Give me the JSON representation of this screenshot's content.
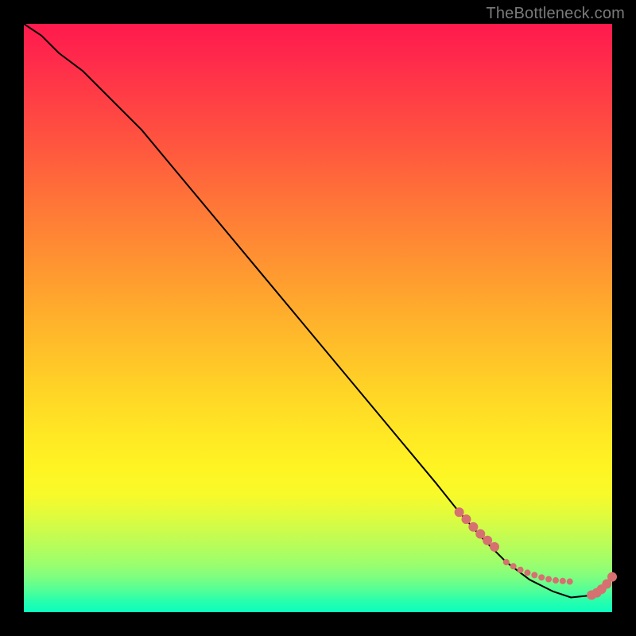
{
  "watermark": "TheBottleneck.com",
  "chart_data": {
    "type": "line",
    "title": "",
    "xlabel": "",
    "ylabel": "",
    "xlim": [
      0,
      100
    ],
    "ylim": [
      0,
      100
    ],
    "grid": false,
    "legend": false,
    "series": [
      {
        "name": "curve",
        "style": "line",
        "color": "#000000",
        "x": [
          0,
          3,
          6,
          10,
          15,
          20,
          25,
          30,
          35,
          40,
          45,
          50,
          55,
          60,
          65,
          70,
          74,
          78,
          82,
          86,
          90,
          93,
          96,
          98,
          100
        ],
        "y": [
          100,
          98,
          95,
          92,
          87,
          82,
          76,
          70,
          64,
          58,
          52,
          46,
          40,
          34,
          28,
          22,
          17,
          12.5,
          8.5,
          5.5,
          3.5,
          2.5,
          2.8,
          4.0,
          6.0
        ]
      },
      {
        "name": "dots-descent",
        "style": "scatter",
        "color": "#d77070",
        "radius_px": 6,
        "x": [
          74,
          75.2,
          76.4,
          77.6,
          78.8,
          80
        ],
        "y": [
          17,
          15.8,
          14.5,
          13.3,
          12.2,
          11.1
        ]
      },
      {
        "name": "dots-trough",
        "style": "scatter",
        "color": "#d77070",
        "radius_px": 4,
        "x": [
          82,
          83.2,
          84.4,
          85.6,
          86.8,
          88,
          89.2,
          90.4,
          91.6,
          92.8
        ],
        "y": [
          8.5,
          7.8,
          7.2,
          6.7,
          6.3,
          5.9,
          5.6,
          5.4,
          5.3,
          5.2
        ]
      },
      {
        "name": "dots-rise",
        "style": "scatter",
        "color": "#d77070",
        "radius_px": 6,
        "x": [
          96.5,
          97.4,
          98.2,
          99.1,
          100
        ],
        "y": [
          2.9,
          3.3,
          3.9,
          4.8,
          6.0
        ]
      }
    ]
  }
}
